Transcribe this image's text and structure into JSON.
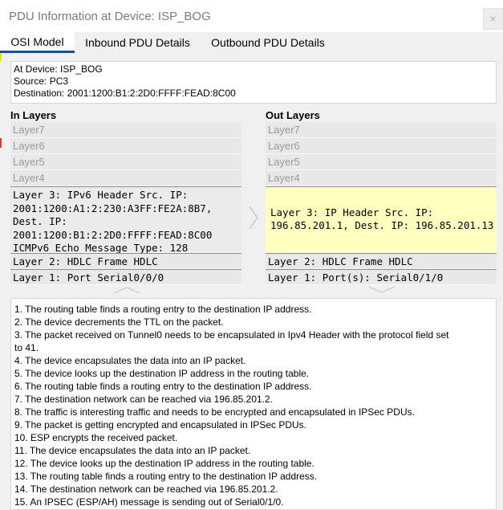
{
  "window": {
    "title": "PDU Information at Device: ISP_BOG",
    "close_glyph": "×"
  },
  "tabs": [
    {
      "label": "OSI Model",
      "active": true
    },
    {
      "label": "Inbound PDU Details",
      "active": false
    },
    {
      "label": "Outbound PDU Details",
      "active": false
    }
  ],
  "info": {
    "device": "At Device: ISP_BOG",
    "source": "Source: PC3",
    "destination": "Destination: 2001:1200:B1:2:2D0:FFFF:FEAD:8C00"
  },
  "in_layers": {
    "heading": "In Layers",
    "layer7": "Layer7",
    "layer6": "Layer6",
    "layer5": "Layer5",
    "layer4": "Layer4",
    "layer3_lines": [
      "Layer 3: IPv6 Header Src. IP:",
      "2001:1200:A1:2:230:A3FF:FE2A:8B7,",
      "Dest. IP:",
      "2001:1200:B1:2:2D0:FFFF:FEAD:8C00",
      "ICMPv6 Echo Message Type: 128"
    ],
    "layer2": "Layer 2: HDLC Frame HDLC",
    "layer1": "Layer 1: Port Serial0/0/0"
  },
  "out_layers": {
    "heading": "Out Layers",
    "layer7": "Layer7",
    "layer6": "Layer6",
    "layer5": "Layer5",
    "layer4": "Layer4",
    "layer3_lines": [
      "Layer 3: IP Header Src. IP:",
      "196.85.201.1, Dest. IP: 196.85.201.13"
    ],
    "layer2": "Layer 2: HDLC Frame HDLC",
    "layer1": "Layer 1: Port(s): Serial0/1/0"
  },
  "steps": [
    "1. The routing table finds a routing entry to the destination IP address.",
    "2. The device decrements the TTL on the packet.",
    "3. The packet received on Tunnel0 needs to be encapsulated in Ipv4 Header with the protocol field set",
    "to 41.",
    "4. The device encapsulates the data into an IP packet.",
    "5. The device looks up the destination IP address in the routing table.",
    "6. The routing table finds a routing entry to the destination IP address.",
    "7. The destination network can be reached via 196.85.201.2.",
    "8. The traffic is interesting traffic and needs to be encrypted and encapsulated in IPSec PDUs.",
    "9. The packet is getting encrypted and encapsulated in IPSec PDUs.",
    "10. ESP encrypts the received packet.",
    "11. The device encapsulates the data into an IP packet.",
    "12. The device looks up the destination IP address in the routing table.",
    "13. The routing table finds a routing entry to the destination IP address.",
    "14. The destination network can be reached via 196.85.201.2.",
    "15. An IPSEC (ESP/AH) message is sending out of Serial0/1/0."
  ],
  "colors": {
    "accent_tab_underline": "#1e4a9a",
    "selected_out_layer": "#ffffc0"
  }
}
